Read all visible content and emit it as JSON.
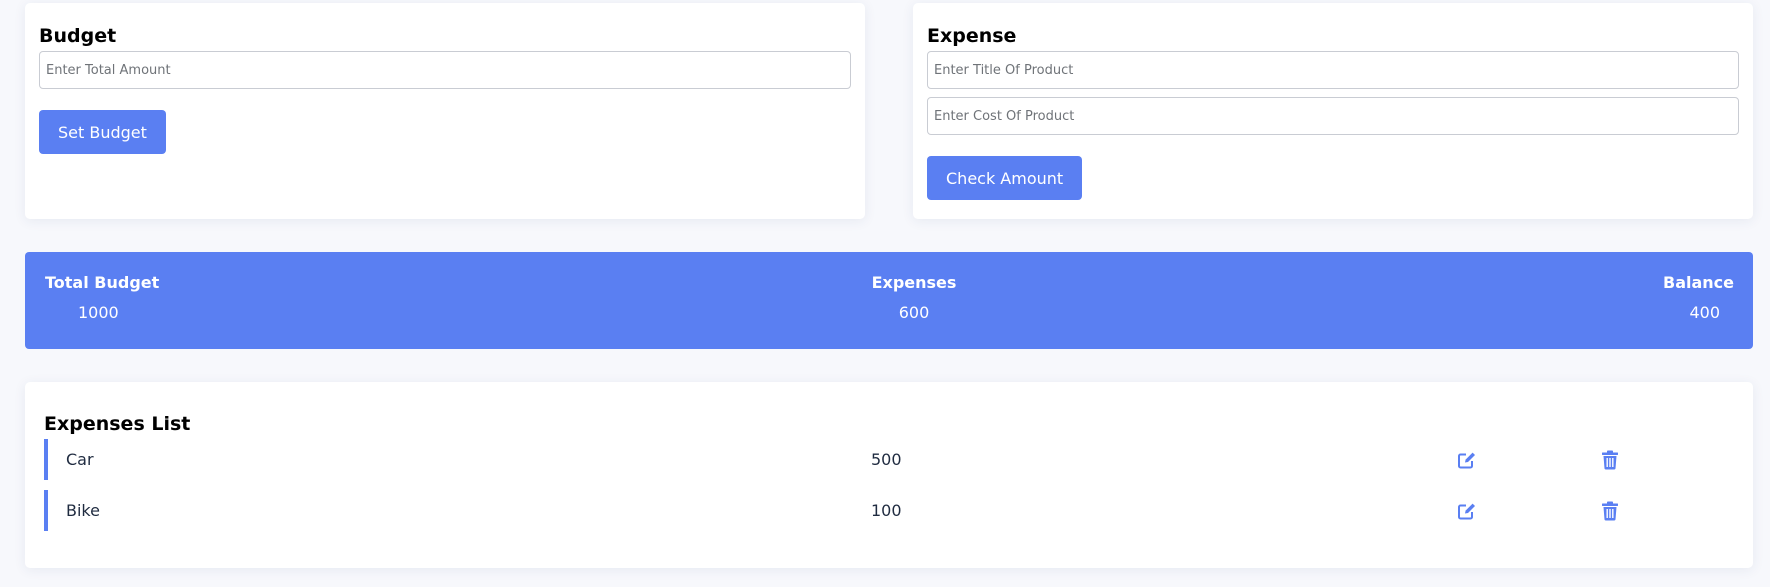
{
  "budget": {
    "title": "Budget",
    "amount_placeholder": "Enter Total Amount",
    "amount_value": "",
    "set_button": "Set Budget"
  },
  "expense": {
    "title": "Expense",
    "product_title_placeholder": "Enter Title Of Product",
    "product_title_value": "",
    "product_cost_placeholder": "Enter Cost Of Product",
    "product_cost_value": "",
    "check_button": "Check Amount"
  },
  "summary": {
    "total_budget_label": "Total Budget",
    "total_budget_value": "1000",
    "expenses_label": "Expenses",
    "expenses_value": "600",
    "balance_label": "Balance",
    "balance_value": "400"
  },
  "expenses_list": {
    "title": "Expenses List",
    "items": [
      {
        "title": "Car",
        "amount": "500",
        "edit_icon": "edit-icon",
        "delete_icon": "trash-icon"
      },
      {
        "title": "Bike",
        "amount": "100",
        "edit_icon": "edit-icon",
        "delete_icon": "trash-icon"
      }
    ]
  },
  "colors": {
    "accent": "#5a7ff2",
    "page_background": "#f7f8fc",
    "card_background": "#ffffff",
    "text_dark": "#1f2b40"
  }
}
